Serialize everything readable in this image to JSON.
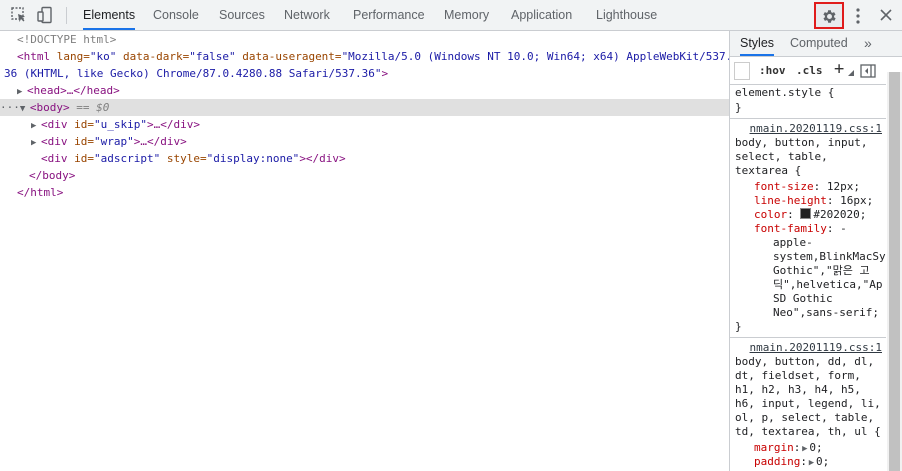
{
  "toolbar": {
    "tabs": [
      "Elements",
      "Console",
      "Sources",
      "Network",
      "Performance",
      "Memory",
      "Application",
      "Lighthouse"
    ],
    "active_tab": "Elements"
  },
  "elements": {
    "lines": [
      {
        "doctype": "<!DOCTYPE html>"
      },
      {
        "html_open_1": "<html",
        "attr1": " lang=",
        "val1": "\"ko\"",
        "attr2": " data-dark=",
        "val2": "\"false\"",
        "attr3": " data-useragent=",
        "val3": "\"Mozilla/5.0 (Windows NT 10.0; Win64; x64) AppleWebKit/537."
      },
      {
        "wrap": "36 (KHTML, like Gecko) Chrome/87.0.4280.88 Safari/537.36\"",
        "close": ">"
      },
      {
        "head": "<head>…</head>"
      },
      {
        "body_tag": "<body>",
        "eq": " == $0",
        "dots": "···"
      },
      {
        "div1_open": "<div",
        "attr": " id=",
        "val": "\"u_skip\"",
        "rest": ">…</div>"
      },
      {
        "div2_open": "<div",
        "attr": " id=",
        "val": "\"wrap\"",
        "rest": ">…</div>"
      },
      {
        "div3_open": "<div",
        "attr": " id=",
        "val": "\"adscript\"",
        "attr2": " style=",
        "val2": "\"display:none\"",
        "rest": "></div>"
      },
      {
        "body_close": "</body>"
      },
      {
        "html_close": "</html>"
      }
    ]
  },
  "styles": {
    "tabs": [
      "Styles",
      "Computed"
    ],
    "more": "»",
    "hov": ":hov",
    "cls": ".cls",
    "plus": "+",
    "element_style": "element.style {",
    "element_style_close": "}",
    "rule1": {
      "source": "nmain.20201119.css:1",
      "selector": [
        "body, button, input,",
        "select, table,",
        "textarea {"
      ],
      "props": [
        {
          "name": "font-size",
          "value": "12px;"
        },
        {
          "name": "line-height",
          "value": "16px;"
        },
        {
          "name": "color",
          "value": "#202020;"
        },
        {
          "name": "font-family",
          "value": "-"
        }
      ],
      "ff_values": [
        "apple-",
        "system,BlinkMacSy",
        "Gothic\",\"맑은 고",
        "딕\",helvetica,\"Ap",
        "SD Gothic",
        "Neo\",sans-serif;"
      ],
      "close": "}"
    },
    "rule2": {
      "source": "nmain.20201119.css:1",
      "selector": [
        "body, button, dd, dl,",
        "dt, fieldset, form,",
        "h1, h2, h3, h4, h5,",
        "h6, input, legend, li,",
        "ol, p, select, table,",
        "td, textarea, th, ul {"
      ],
      "props": [
        {
          "name": "margin",
          "value": "0;"
        },
        {
          "name": "padding",
          "value": "0;"
        }
      ]
    }
  }
}
